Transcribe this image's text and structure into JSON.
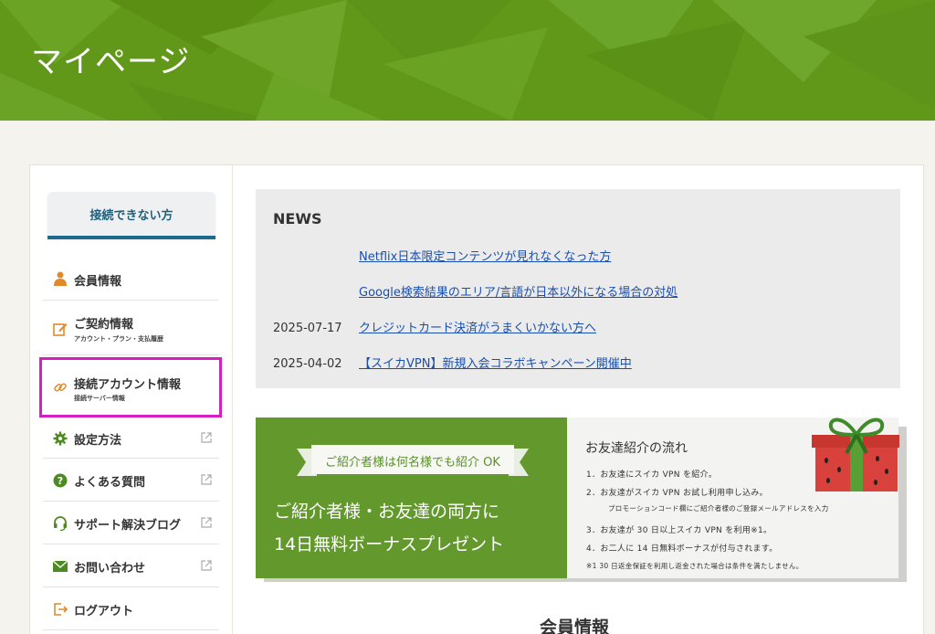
{
  "header": {
    "title": "マイページ"
  },
  "sidebar": {
    "cant_connect_label": "接続できない方",
    "items": [
      {
        "label": "会員情報",
        "icon": "person-icon"
      },
      {
        "label": "ご契約情報",
        "sub": "アカウント・プラン・支払履歴",
        "icon": "edit-icon"
      },
      {
        "label": "接続アカウント情報",
        "sub": "接続サーバー情報",
        "icon": "link-icon"
      },
      {
        "label": "設定方法",
        "icon": "gear-icon"
      },
      {
        "label": "よくある質問",
        "icon": "question-icon"
      },
      {
        "label": "サポート解決ブログ",
        "icon": "headset-icon"
      },
      {
        "label": "お問い合わせ",
        "icon": "mail-icon"
      },
      {
        "label": "ログアウト",
        "icon": "logout-icon"
      }
    ]
  },
  "news": {
    "title": "NEWS",
    "rows": [
      {
        "date": "",
        "text": "Netflix日本限定コンテンツが見れなくなった方"
      },
      {
        "date": "",
        "text": "Google検索結果のエリア/言語が日本以外になる場合の対処"
      },
      {
        "date": "2025-07-17",
        "text": "クレジットカード決済がうまくいかない方へ"
      },
      {
        "date": "2025-04-02",
        "text": "【スイカVPN】新規入会コラボキャンペーン開催中"
      }
    ]
  },
  "banner": {
    "ribbon": "ご紹介者様は何名様でも紹介 OK",
    "main_line1": "ご紹介者様・お友達の両方に",
    "main_line2": "14日無料ボーナスプレゼント",
    "flow_title": "お友達紹介の流れ",
    "steps": [
      "1．お友達にスイカ VPN を紹介。",
      "2．お友達がスイカ VPN お試し利用申し込み。",
      "プロモーションコード欄にご紹介者様のご登録メールアドレスを入力",
      "3．お友達が 30 日以上スイカ VPN を利用※1。",
      "4．お二人に 14 日無料ボーナスが付与されます。",
      "※1 30 日返金保証を利用し返金された場合は条件を満たしません。"
    ]
  },
  "section": {
    "title": "会員情報"
  },
  "colors": {
    "brand_green": "#62981a",
    "highlight": "#d61fc0",
    "link": "#1a4fae"
  }
}
